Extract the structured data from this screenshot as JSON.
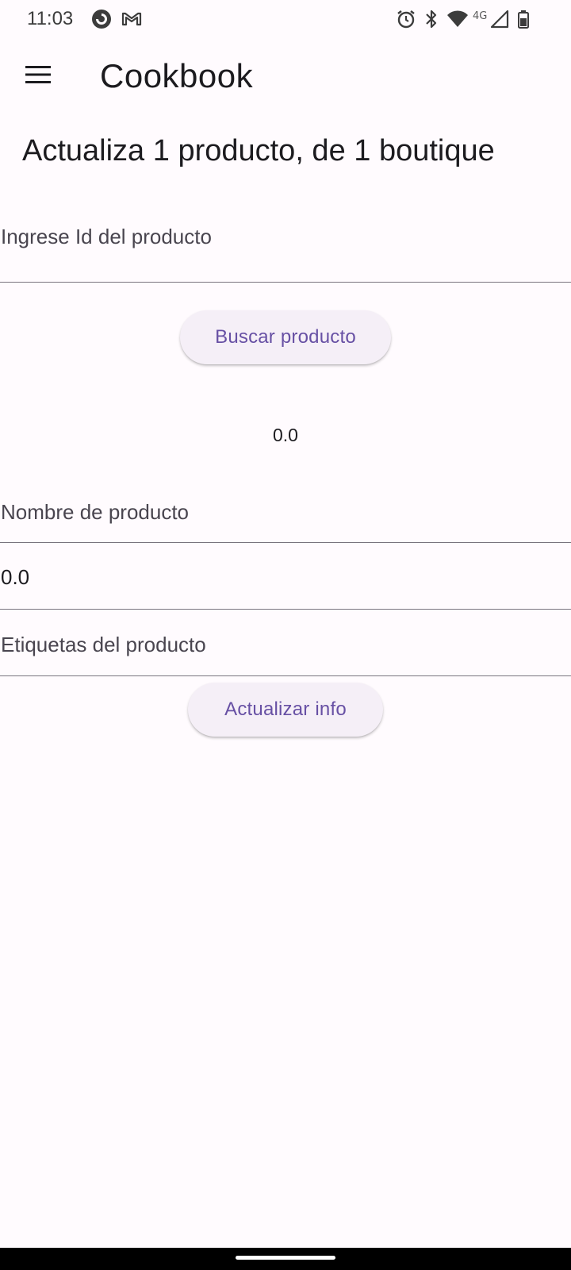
{
  "status_bar": {
    "time": "11:03",
    "left_icons": [
      "pocketcasts-icon",
      "gmail-icon"
    ],
    "right_icons": [
      "alarm-icon",
      "bluetooth-icon",
      "wifi-icon",
      "signal-icon",
      "battery-icon"
    ],
    "network_label": "4G"
  },
  "app_bar": {
    "menu_icon": "menu-icon",
    "title": "Cookbook"
  },
  "page": {
    "heading": "Actualiza 1 producto, de 1 boutique",
    "product_id_field": {
      "placeholder": "Ingrese Id del producto",
      "value": ""
    },
    "search_button_label": "Buscar producto",
    "result_value": "0.0",
    "product_name_field": {
      "label": "Nombre de producto"
    },
    "price_field": {
      "value": "0.0"
    },
    "tags_field": {
      "label": "Etiquetas del producto"
    },
    "update_button_label": "Actualizar info"
  },
  "colors": {
    "background": "#fffbfe",
    "accent": "#6750a4",
    "button_surface": "#f5eff7",
    "divider": "#79747e"
  }
}
